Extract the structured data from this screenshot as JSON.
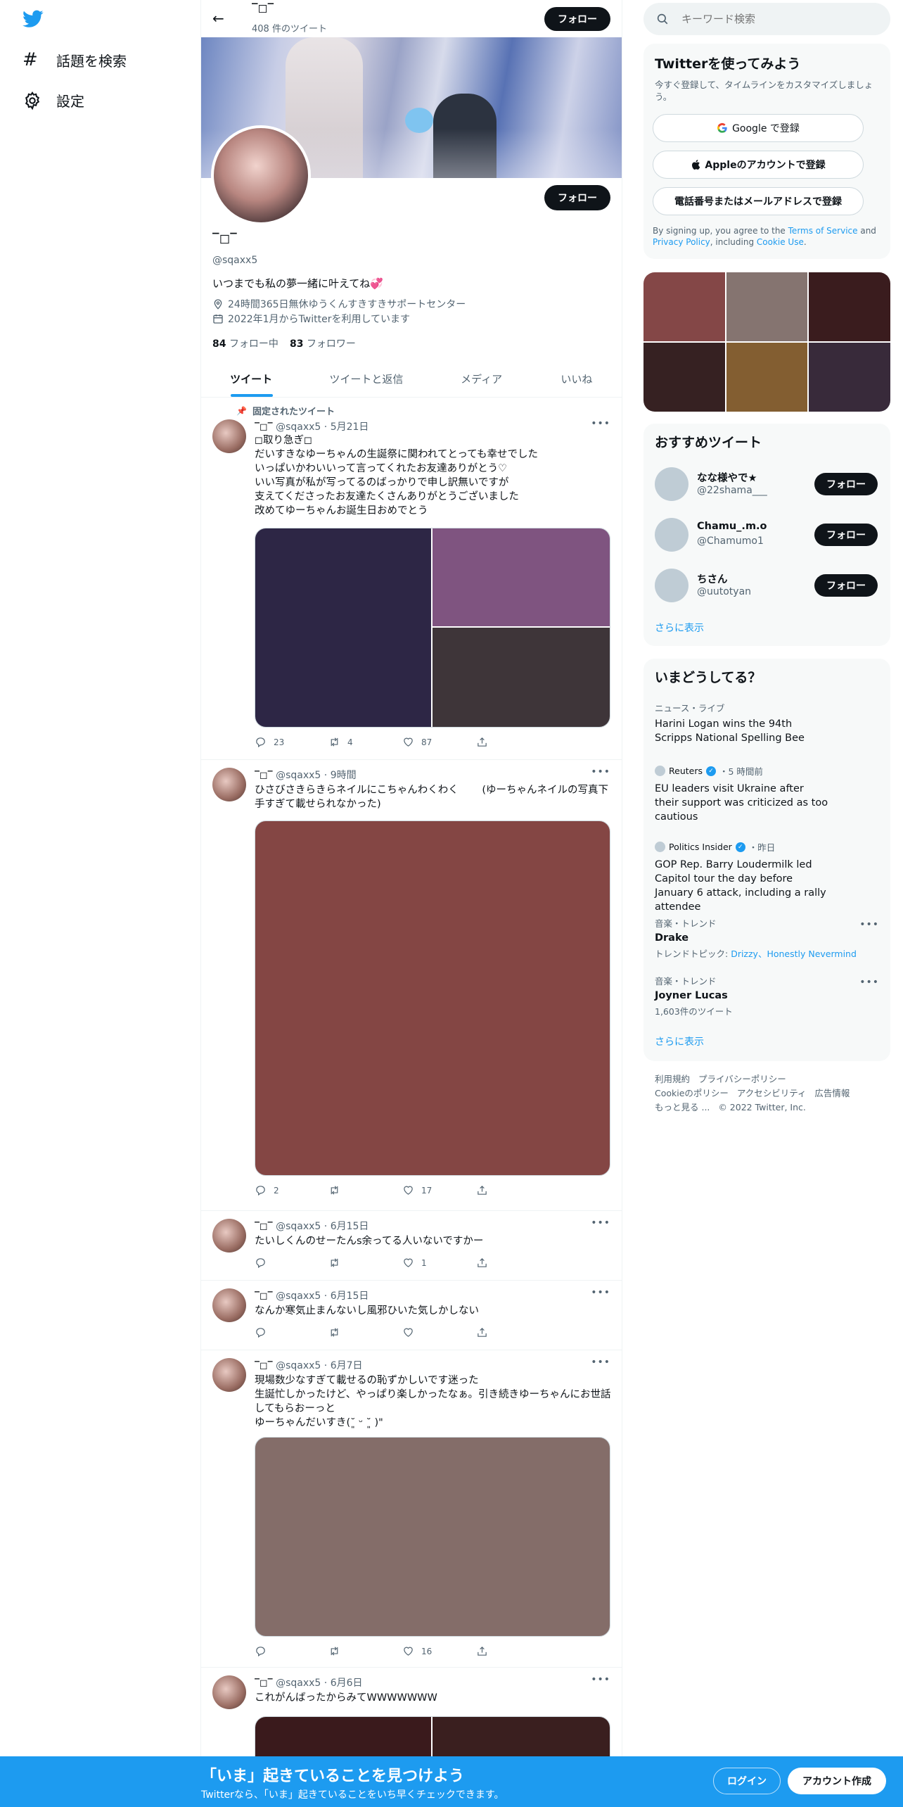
{
  "nav": {
    "search_topics": "話題を検索",
    "settings": "設定"
  },
  "header": {
    "name": "‾◻‾",
    "tweet_count": "408 件のツイート",
    "follow": "フォロー"
  },
  "profile": {
    "name": "‾◻‾",
    "handle": "@sqaxx5",
    "bio": "いつまでも私の夢一緒に叶えてね💞",
    "location": "24時間365日無休ゆうくんすきすきサポートセンター",
    "joined": "2022年1月からTwitterを利用しています",
    "following_count": "84",
    "following_label": "フォロー中",
    "followers_count": "83",
    "followers_label": "フォロワー",
    "follow": "フォロー"
  },
  "tabs": [
    "ツイート",
    "ツイートと返信",
    "メディア",
    "いいね"
  ],
  "pinned_label": "固定されたツイート",
  "tweets": [
    {
      "name": "‾◻‾",
      "handle": "@sqaxx5",
      "time": "5月21日",
      "text": "◻取り急ぎ◻\nだいすきなゆーちゃんの生誕祭に関われてとっても幸せでした\nいっぱいかわいいって言ってくれたお友達ありがとう♡\nいい写真が私が写ってるのばっかりで申し訳無いですが\n支えてくださったお友達たくさんありがとうございました\n改めてゆーちゃんお誕生日おめでとう",
      "replies": "23",
      "retweets": "4",
      "likes": "87"
    },
    {
      "name": "‾◻‾",
      "handle": "@sqaxx5",
      "time": "9時間",
      "text": "ひさびさきらきらネイルにこちゃんわくわく　　 (ゆーちゃんネイルの写真下手すぎて載せられなかった)",
      "replies": "2",
      "retweets": "",
      "likes": "17"
    },
    {
      "name": "‾◻‾",
      "handle": "@sqaxx5",
      "time": "6月15日",
      "text": "たいしくんのせーたんs余ってる人いないですかー",
      "replies": "",
      "retweets": "",
      "likes": "1"
    },
    {
      "name": "‾◻‾",
      "handle": "@sqaxx5",
      "time": "6月15日",
      "text": "なんか寒気止まんないし風邪ひいた気しかしない",
      "replies": "",
      "retweets": "",
      "likes": ""
    },
    {
      "name": "‾◻‾",
      "handle": "@sqaxx5",
      "time": "6月7日",
      "text": "現場数少なすぎて載せるの恥ずかしいです迷った\n生誕忙しかったけど、やっぱり楽しかったなぁ。引き続きゆーちゃんにお世話してもらおーっと\nゆーちゃんだいすき(˘͈ ᵕ ˘͈ )\"",
      "replies": "",
      "retweets": "",
      "likes": "16"
    },
    {
      "name": "‾◻‾",
      "handle": "@sqaxx5",
      "time": "6月6日",
      "text": "これがんばったからみてWWWWWWW"
    }
  ],
  "search": {
    "placeholder": "キーワード検索"
  },
  "signup": {
    "title": "Twitterを使ってみよう",
    "subtitle": "今すぐ登録して、タイムラインをカスタマイズしましょう。",
    "google": "Google で登録",
    "apple": "Appleのアカウントで登録",
    "phone": "電話番号またはメールアドレスで登録",
    "legal_pre": "By signing up, you agree to the ",
    "terms": "Terms of Service",
    "and": " and ",
    "privacy": "Privacy Policy",
    "including": ", including ",
    "cookie": "Cookie Use",
    "dot": "."
  },
  "media_grid_colors": [
    "#844747",
    "#857470",
    "#3a1c1e",
    "#362122",
    "#835e31",
    "#382a3a"
  ],
  "recommend": {
    "title": "おすすめツイート",
    "users": [
      {
        "name": "なな様やで★",
        "handle": "@22shama___"
      },
      {
        "name": "Chamu_.m.o",
        "handle": "@Chamumo1"
      },
      {
        "name": "ちさん",
        "handle": "@uutotyan"
      }
    ],
    "follow": "フォロー",
    "more": "さらに表示"
  },
  "trends": {
    "title": "いまどうしてる？",
    "items": [
      {
        "meta": "ニュース・ライブ",
        "title": "Harini Logan wins the 94th Scripps National Spelling Bee"
      },
      {
        "source": "Reuters",
        "time": "・5 時間前",
        "title": "EU leaders visit Ukraine after their support was criticized as too cautious"
      },
      {
        "source": "Politics Insider",
        "time": "・昨日",
        "title": "GOP Rep. Barry Loudermilk led Capitol tour the day before January 6 attack, including a rally attendee"
      },
      {
        "meta": "音楽・トレンド",
        "title": "Drake",
        "topics_label": "トレンドトピック: ",
        "topics": "Drizzy、Honestly Nevermind"
      },
      {
        "meta": "音楽・トレンド",
        "title": "Joyner Lucas",
        "count": "1,603件のツイート"
      }
    ],
    "more": "さらに表示"
  },
  "footer": {
    "links": [
      "利用規約",
      "プライバシーポリシー",
      "Cookieのポリシー",
      "アクセシビリティ",
      "広告情報",
      "もっと見る ..."
    ],
    "copyright": "© 2022 Twitter, Inc."
  },
  "banner": {
    "title": "「いま」起きていることを見つけよう",
    "subtitle": "Twitterなら、「いま」起きていることをいち早くチェックできます。",
    "login": "ログイン",
    "signup": "アカウント作成"
  },
  "colors": {
    "accent": "#1d9bf0",
    "tweet1_media": [
      "#2d2645",
      "#7f5480",
      "#3e3539"
    ],
    "tweet2_media": "#844644",
    "tweet5_media": "#846d69",
    "tweet6_media": [
      "#3a1a1c",
      "#3a1f1f"
    ]
  }
}
